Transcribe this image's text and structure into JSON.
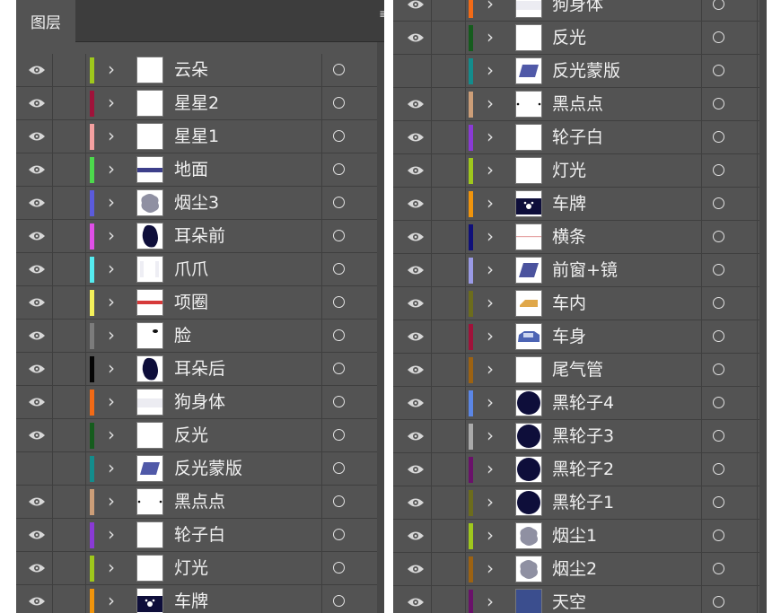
{
  "panel": {
    "tab_label": "图层",
    "menu_glyph": "≡"
  },
  "left_layers": [
    {
      "name": "云朵",
      "visible": true,
      "color": "#9fc81c",
      "thumb": "blank"
    },
    {
      "name": "星星2",
      "visible": true,
      "color": "#a0123a",
      "thumb": "blank"
    },
    {
      "name": "星星1",
      "visible": true,
      "color": "#f4a0a0",
      "thumb": "blank"
    },
    {
      "name": "地面",
      "visible": true,
      "color": "#4cd94c",
      "thumb": "ground"
    },
    {
      "name": "烟尘3",
      "visible": true,
      "color": "#5b5bdc",
      "thumb": "dust"
    },
    {
      "name": "耳朵前",
      "visible": true,
      "color": "#e04fe8",
      "thumb": "ear"
    },
    {
      "name": "爪爪",
      "visible": true,
      "color": "#55ecf0",
      "thumb": "paws"
    },
    {
      "name": "项圈",
      "visible": true,
      "color": "#f3f05a",
      "thumb": "collar"
    },
    {
      "name": "脸",
      "visible": true,
      "color": "#7c7c7c",
      "thumb": "face"
    },
    {
      "name": "耳朵后",
      "visible": true,
      "color": "#050505",
      "thumb": "ear"
    },
    {
      "name": "狗身体",
      "visible": true,
      "color": "#f26a16",
      "thumb": "body"
    },
    {
      "name": "反光",
      "visible": true,
      "color": "#155c1d",
      "thumb": "blank"
    },
    {
      "name": "反光蒙版",
      "visible": false,
      "color": "#138c8c",
      "thumb": "mask"
    },
    {
      "name": "黑点点",
      "visible": true,
      "color": "#cc9e78",
      "thumb": "dots"
    },
    {
      "name": "轮子白",
      "visible": true,
      "color": "#8a3ad6",
      "thumb": "blank"
    },
    {
      "name": "灯光",
      "visible": true,
      "color": "#9fc81c",
      "thumb": "blank"
    },
    {
      "name": "车牌",
      "visible": true,
      "color": "#f0940c",
      "thumb": "plate"
    }
  ],
  "right_layers": [
    {
      "name": "狗身体",
      "visible": true,
      "color": "#f26a16",
      "thumb": "body"
    },
    {
      "name": "反光",
      "visible": true,
      "color": "#155c1d",
      "thumb": "blank"
    },
    {
      "name": "反光蒙版",
      "visible": false,
      "color": "#138c8c",
      "thumb": "mask"
    },
    {
      "name": "黑点点",
      "visible": true,
      "color": "#cc9e78",
      "thumb": "dots"
    },
    {
      "name": "轮子白",
      "visible": true,
      "color": "#8a3ad6",
      "thumb": "blank"
    },
    {
      "name": "灯光",
      "visible": true,
      "color": "#9fc81c",
      "thumb": "blank"
    },
    {
      "name": "车牌",
      "visible": true,
      "color": "#f0940c",
      "thumb": "plate"
    },
    {
      "name": "横条",
      "visible": true,
      "color": "#10107a",
      "thumb": "stripe"
    },
    {
      "name": "前窗+镜",
      "visible": true,
      "color": "#9a9ae6",
      "thumb": "window"
    },
    {
      "name": "车内",
      "visible": true,
      "color": "#6c6c1c",
      "thumb": "interior"
    },
    {
      "name": "车身",
      "visible": true,
      "color": "#a0123a",
      "thumb": "car"
    },
    {
      "name": "尾气管",
      "visible": true,
      "color": "#9c6212",
      "thumb": "blank"
    },
    {
      "name": "黑轮子4",
      "visible": true,
      "color": "#5b86e6",
      "thumb": "wheel"
    },
    {
      "name": "黑轮子3",
      "visible": true,
      "color": "#aaaaaa",
      "thumb": "wheel"
    },
    {
      "name": "黑轮子2",
      "visible": true,
      "color": "#6a116a",
      "thumb": "wheel"
    },
    {
      "name": "黑轮子1",
      "visible": true,
      "color": "#6c6c1c",
      "thumb": "wheel"
    },
    {
      "name": "烟尘1",
      "visible": true,
      "color": "#9fc81c",
      "thumb": "dust"
    },
    {
      "name": "烟尘2",
      "visible": true,
      "color": "#9c6212",
      "thumb": "dust"
    },
    {
      "name": "天空",
      "visible": true,
      "color": "#6a116a",
      "thumb": "sky"
    }
  ]
}
